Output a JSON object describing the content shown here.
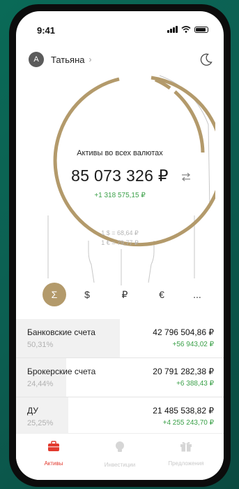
{
  "status": {
    "time": "9:41"
  },
  "user": {
    "initial": "А",
    "name": "Татьяна",
    "chevron": "›"
  },
  "summary": {
    "title": "Активы во всех валютах",
    "total": "85 073 326 ₽",
    "delta": "+1 318 575,15 ₽",
    "rate_usd": "1 $ = 68,64 ₽",
    "rate_eur": "1 € = 79,77 ₽"
  },
  "currencies": [
    {
      "symbol": "Σ",
      "active": true
    },
    {
      "symbol": "$",
      "active": false
    },
    {
      "symbol": "₽",
      "active": false
    },
    {
      "symbol": "€",
      "active": false
    },
    {
      "symbol": "...",
      "active": false
    }
  ],
  "accounts": [
    {
      "name": "Банковские счета",
      "percent": "50,31%",
      "share": 0.5031,
      "value": "42 796 504,86 ₽",
      "delta": "+56 943,02 ₽"
    },
    {
      "name": "Брокерские счета",
      "percent": "24,44%",
      "share": 0.2444,
      "value": "20 791 282,38 ₽",
      "delta": "+6 388,43 ₽"
    },
    {
      "name": "ДУ",
      "percent": "25,25%",
      "share": 0.2525,
      "value": "21 485 538,82 ₽",
      "delta": "+4 255 243,70 ₽"
    }
  ],
  "tabs": [
    {
      "label": "Активы",
      "icon": "briefcase-icon",
      "active": true
    },
    {
      "label": "Инвестиции",
      "icon": "lightbulb-icon",
      "active": false
    },
    {
      "label": "Предложения",
      "icon": "gift-icon",
      "active": false
    }
  ],
  "colors": {
    "accent": "#b39a6b",
    "positive": "#3aa048",
    "active_tab": "#e23a2e"
  }
}
